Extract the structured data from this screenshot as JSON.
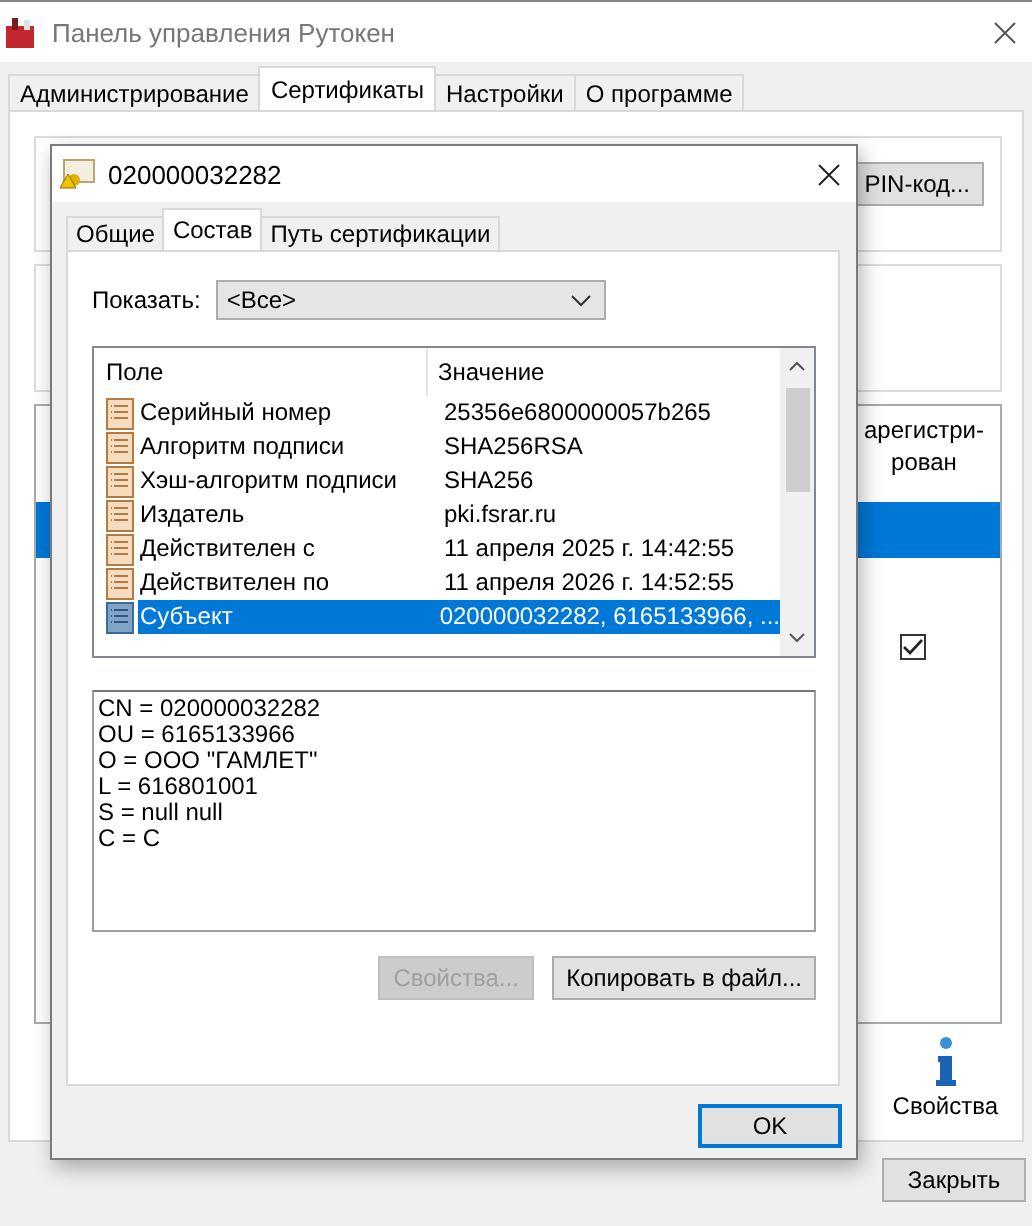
{
  "window": {
    "title": "Панель управления Рутокен",
    "tabs": [
      {
        "label": "Администрирование",
        "selected": false
      },
      {
        "label": "Сертификаты",
        "selected": true
      },
      {
        "label": "Настройки",
        "selected": false
      },
      {
        "label": "О программе",
        "selected": false
      }
    ],
    "pin_button": "PIN-код...",
    "table": {
      "column_header": "арегистри-рован",
      "row_selected": true,
      "checked": true
    },
    "properties_button": "Свойства",
    "close_button": "Закрыть"
  },
  "dialog": {
    "title": "020000032282",
    "tabs": [
      {
        "label": "Общие",
        "selected": false
      },
      {
        "label": "Состав",
        "selected": true
      },
      {
        "label": "Путь сертификации",
        "selected": false
      }
    ],
    "show_label": "Показать:",
    "show_value": "<Все>",
    "list": {
      "columns": [
        "Поле",
        "Значение"
      ],
      "rows": [
        {
          "field": "Серийный номер",
          "value": "25356e6800000057b265",
          "selected": false
        },
        {
          "field": "Алгоритм подписи",
          "value": "SHA256RSA",
          "selected": false
        },
        {
          "field": "Хэш-алгоритм подписи",
          "value": "SHA256",
          "selected": false
        },
        {
          "field": "Издатель",
          "value": "pki.fsrar.ru",
          "selected": false
        },
        {
          "field": "Действителен с",
          "value": "11 апреля 2025 г. 14:42:55",
          "selected": false
        },
        {
          "field": "Действителен по",
          "value": "11 апреля 2026 г. 14:52:55",
          "selected": false
        },
        {
          "field": "Субъект",
          "value": "020000032282, 6165133966, ...",
          "selected": true
        }
      ]
    },
    "details": [
      "CN = 020000032282",
      "OU = 6165133966",
      "O = ООО \"ГАМЛЕТ\"",
      "L = 616801001",
      "S = null null",
      "C = C"
    ],
    "buttons": [
      {
        "label": "Свойства...",
        "disabled": true
      },
      {
        "label": "Копировать в файл...",
        "disabled": false
      }
    ],
    "ok_button": "OK"
  }
}
